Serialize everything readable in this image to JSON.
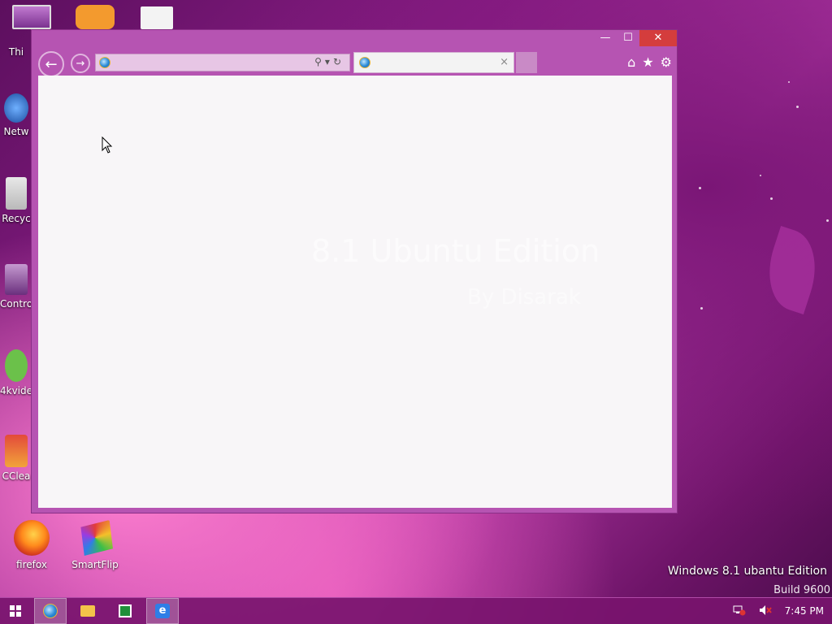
{
  "desktop": {
    "icons_left": [
      {
        "label": "Thi",
        "icon": "computer-icon"
      },
      {
        "label": "Netw",
        "icon": "network-icon"
      },
      {
        "label": "Recyc",
        "icon": "recycle-bin-icon"
      },
      {
        "label": "Contro",
        "icon": "control-panel-icon"
      },
      {
        "label": "4kvide",
        "icon": "4kvideo-icon"
      },
      {
        "label": "CClea",
        "icon": "ccleaner-icon"
      }
    ],
    "icons_bottom": [
      {
        "label": "firefox",
        "icon": "firefox-icon"
      },
      {
        "label": "SmartFlip",
        "icon": "smartflip-icon"
      }
    ],
    "edition_text": "Windows 8.1 ubantu Edition",
    "build_text": "Build 9600"
  },
  "browser": {
    "window_controls": {
      "minimize": "—",
      "maximize": "☐",
      "close": "✕"
    },
    "address_value": "",
    "tab_title": "",
    "tab_close": "×",
    "address_tools": "⚲▾↻",
    "right_icons": {
      "home": "⌂",
      "favorites": "★",
      "settings": "⚙"
    }
  },
  "wallpaper_watermark": {
    "title": "8.1 Ubuntu Edition",
    "subtitle": "By Disarak"
  },
  "taskbar": {
    "clock": "7:45 PM"
  }
}
